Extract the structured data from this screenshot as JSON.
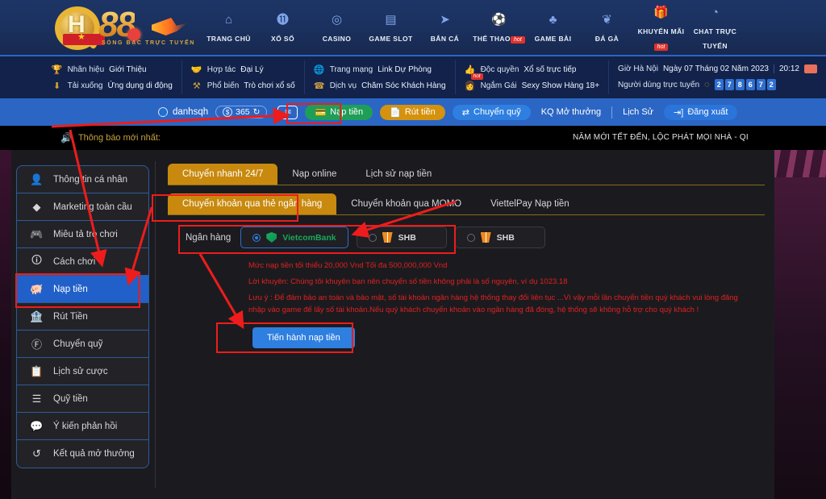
{
  "nav": {
    "items": [
      {
        "label": "TRANG CHỦ",
        "icon": "home-icon",
        "hot": false
      },
      {
        "label": "XỔ SỐ",
        "icon": "lottery-ball-icon",
        "hot": false
      },
      {
        "label": "CASINO",
        "icon": "casino-chip-icon",
        "hot": false
      },
      {
        "label": "GAME SLOT",
        "icon": "slot-machine-icon",
        "hot": false
      },
      {
        "label": "BẮN CÁ",
        "icon": "fish-icon",
        "hot": false
      },
      {
        "label": "THỂ THAO",
        "icon": "soccer-ball-icon",
        "hot": true
      },
      {
        "label": "GAME BÀI",
        "icon": "playing-cards-icon",
        "hot": false
      },
      {
        "label": "ĐÁ GÀ",
        "icon": "rooster-icon",
        "hot": false
      },
      {
        "label": "KHUYẾN MÃI",
        "icon": "gift-icon",
        "hot": true
      },
      {
        "label": "CHAT TRỰC\nTUYẾN",
        "icon": "chat-icon",
        "hot": false
      }
    ],
    "hot_label": "hot",
    "logo": {
      "letter": "H",
      "number": "88",
      "tagline": "SÒNG BẠC TRỰC TUYẾN"
    }
  },
  "infobar": {
    "groups": [
      {
        "rows": [
          {
            "icon": "trophy-icon",
            "key": "Nhãn hiệu",
            "value": "Giới Thiệu"
          },
          {
            "icon": "download-icon",
            "key": "Tải xuống",
            "value": "Ứng dụng di động"
          }
        ]
      },
      {
        "rows": [
          {
            "icon": "handshake-icon",
            "key": "Hợp tác",
            "value": "Đại Lý"
          },
          {
            "icon": "popular-icon",
            "key": "Phổ biến",
            "value": "Trò chơi xổ số"
          }
        ]
      },
      {
        "rows": [
          {
            "icon": "globe-icon",
            "key": "Trang mạng",
            "value": "Link Dự Phòng"
          },
          {
            "icon": "support-icon",
            "key": "Dịch vụ",
            "value": "Chăm Sóc Khách Hàng"
          }
        ]
      },
      {
        "rows": [
          {
            "icon": "thumbup-icon",
            "key": "Độc quyền",
            "value": "Xổ số trực tiếp"
          },
          {
            "icon": "girl-icon",
            "key": "Ngắm Gái",
            "value": "Sexy Show Hàng 18+",
            "hot": "hot"
          }
        ]
      }
    ],
    "clock": {
      "zone_label": "Giờ Hà Nội",
      "date": "Ngày 07 Tháng 02 Năm 2023",
      "time": "20:12",
      "online_label": "Người dùng trực tuyến",
      "online_digits": [
        "2",
        "7",
        "8",
        "6",
        "7",
        "2"
      ]
    }
  },
  "userbar": {
    "username": "danhsqh",
    "balance": "365",
    "balance_icon": "coin-icon",
    "refresh_icon": "refresh-icon",
    "user_icon": "user-icon",
    "mail_icon": "mail-icon",
    "buttons": [
      {
        "label": "Nạp tiền",
        "icon": "deposit-icon",
        "style": "green"
      },
      {
        "label": "Rút tiền",
        "icon": "withdraw-icon",
        "style": "orange"
      },
      {
        "label": "Chuyển quỹ",
        "icon": "transfer-icon",
        "style": "blue"
      }
    ],
    "links": [
      "KQ Mở thưởng",
      "Lịch Sử"
    ],
    "logout": {
      "label": "Đăng xuất",
      "icon": "logout-icon"
    }
  },
  "notice": {
    "speaker_icon": "speaker-icon",
    "label": "Thông báo mới nhất:",
    "marquee": "NĂM MỚI TẾT ĐẾN, LỘC PHÁT MỌI NHÀ - QI"
  },
  "sidebar": {
    "items": [
      {
        "label": "Thông tin cá nhân",
        "icon": "profile-icon",
        "active": false
      },
      {
        "label": "Marketing toàn cầu",
        "icon": "diamond-icon",
        "active": false
      },
      {
        "label": "Miêu tả trò chơi",
        "icon": "gamepad-icon",
        "active": false
      },
      {
        "label": "Cách chơi",
        "icon": "info-icon",
        "active": false
      },
      {
        "label": "Nạp tiền",
        "icon": "piggybank-icon",
        "active": true
      },
      {
        "label": "Rút Tiền",
        "icon": "cashout-icon",
        "active": false
      },
      {
        "label": "Chuyển quỹ",
        "icon": "dollar-circle-icon",
        "active": false
      },
      {
        "label": "Lịch sử cược",
        "icon": "history-list-icon",
        "active": false
      },
      {
        "label": "Quỹ tiền",
        "icon": "fund-icon",
        "active": false
      },
      {
        "label": "Ý kiến phản hồi",
        "icon": "feedback-icon",
        "active": false
      },
      {
        "label": "Kết quả mở thưởng",
        "icon": "clock-rewind-icon",
        "active": false
      }
    ]
  },
  "main": {
    "tabs_primary": [
      {
        "label": "Chuyển nhanh 24/7",
        "active": true
      },
      {
        "label": "Nạp online",
        "active": false
      },
      {
        "label": "Lịch sử nạp tiền",
        "active": false
      }
    ],
    "tabs_secondary": [
      {
        "label": "Chuyển khoản qua thẻ ngân hàng",
        "active": true
      },
      {
        "label": "Chuyển khoản qua MOMO",
        "active": false
      },
      {
        "label": "ViettelPay Nạp tiền",
        "active": false
      }
    ],
    "bank": {
      "label": "Ngân hàng",
      "options": [
        {
          "name": "VietcomBank",
          "logo": "vietcombank-logo",
          "selected": true
        },
        {
          "name": "SHB",
          "logo": "shb-logo",
          "selected": false
        },
        {
          "name": "SHB",
          "logo": "shb-logo",
          "selected": false
        }
      ]
    },
    "notes": [
      "Mức nạp tiền tối thiểu 20,000 Vnd Tối đa 500,000,000 Vnd",
      "Lời khuyên: Chúng tôi khuyên bạn nên chuyển số tiền không phải là số nguyên, ví dụ 1023.18",
      "Lưu ý : Để đảm bảo an toàn và bảo mật, số tài khoản ngân hàng hệ thống thay đổi liên tục ...Vì vậy mỗi lần chuyển tiền quý khách vui lòng đăng nhập vào game để lấy số tài khoản.Nếu quý khách chuyển khoản vào ngân hàng đã đóng, hệ thống sẽ không hỗ trợ cho quý khách !"
    ],
    "submit_label": "Tiến hành nạp tiền"
  },
  "colors": {
    "nav_bg": "#1d3566",
    "info_bg": "#12224a",
    "userbar_bg": "#2b66c4",
    "accent_gold": "#c8890e",
    "accent_blue": "#2e7fe0",
    "annotation_red": "#ee1c1c",
    "note_red": "#e02020",
    "sidebar_active": "#2060c8"
  }
}
